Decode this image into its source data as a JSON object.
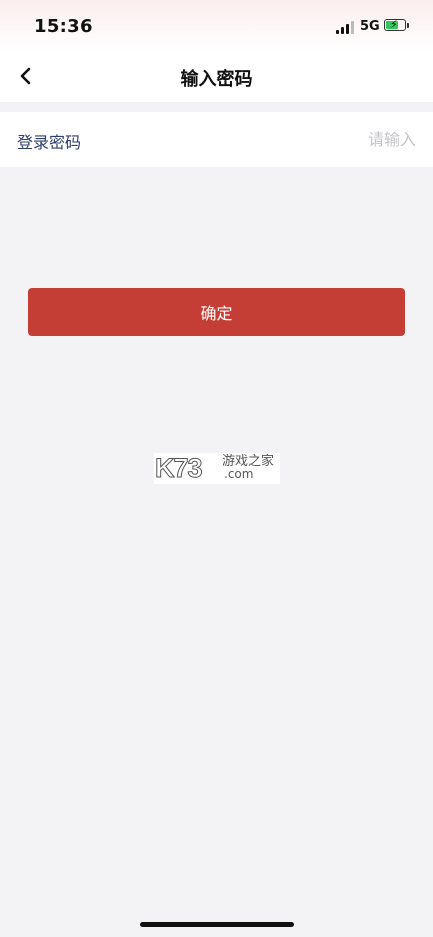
{
  "status_bar": {
    "time": "15:36",
    "network": "5G",
    "signal_bars": 4,
    "battery_level": 0.7,
    "battery_charging": true,
    "battery_bolt": "⚡"
  },
  "nav": {
    "back_icon": "chevron-left-icon",
    "title": "输入密码"
  },
  "form": {
    "label": "登录密码",
    "value": "",
    "placeholder": "请输入"
  },
  "confirm_label": "确定",
  "watermark": {
    "brand": "K73",
    "site_name": "游戏之家",
    "domain": ".com"
  },
  "colors": {
    "accent": "#c53e36",
    "label_text": "#2f3d6b",
    "background": "#f3f3f5"
  }
}
